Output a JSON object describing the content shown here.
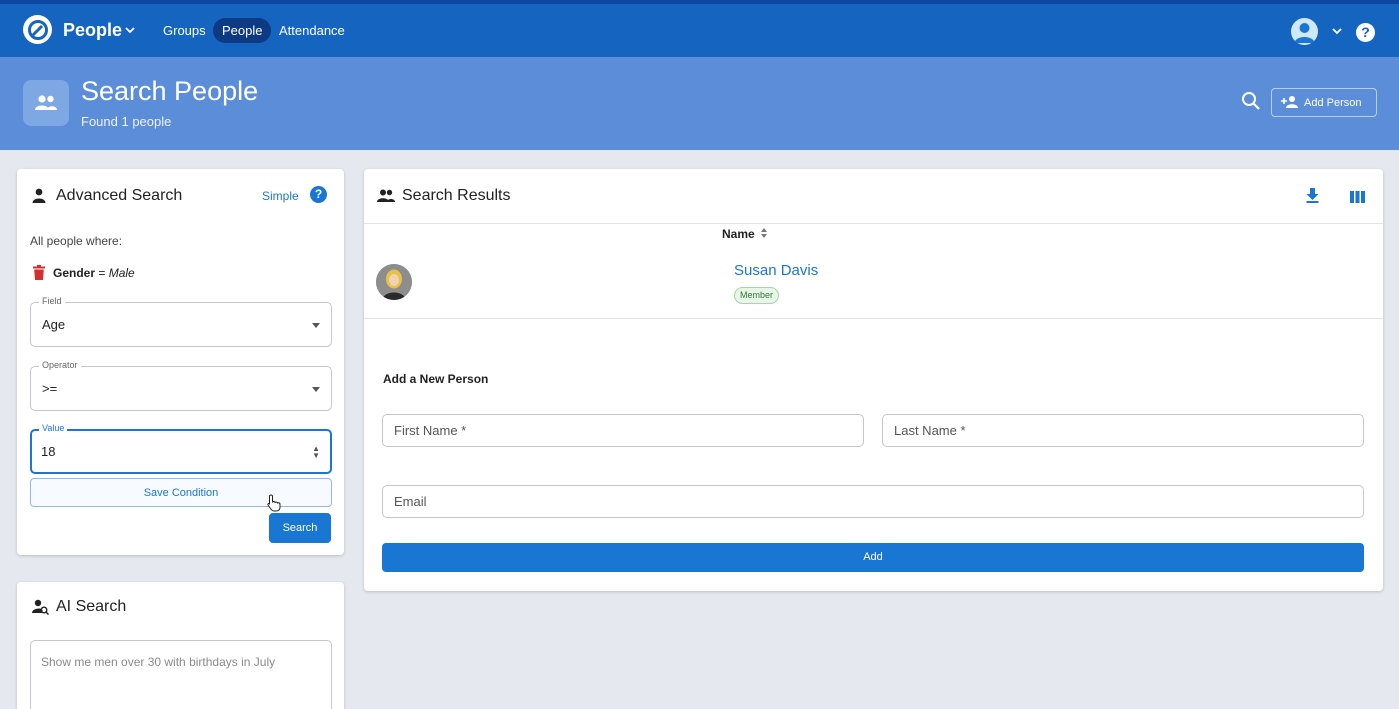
{
  "app": {
    "title": "People"
  },
  "nav": {
    "items": [
      {
        "label": "Groups",
        "active": false
      },
      {
        "label": "People",
        "active": true
      },
      {
        "label": "Attendance",
        "active": false
      }
    ]
  },
  "header": {
    "title": "Search People",
    "subtitle": "Found 1 people",
    "add_person_label": "Add Person"
  },
  "advanced": {
    "title": "Advanced Search",
    "simple_link": "Simple",
    "intro": "All people where:",
    "condition": {
      "field": "Gender",
      "op": "=",
      "value": "Male"
    },
    "field": {
      "legend": "Field",
      "value": "Age"
    },
    "operator": {
      "legend": "Operator",
      "value": ">="
    },
    "value": {
      "legend": "Value",
      "value": "18"
    },
    "save_label": "Save Condition",
    "search_label": "Search"
  },
  "ai": {
    "title": "AI Search",
    "placeholder": "Show me men over 30 with birthdays in July"
  },
  "results": {
    "title": "Search Results",
    "column_name": "Name",
    "rows": [
      {
        "name": "Susan Davis",
        "badge": "Member"
      }
    ]
  },
  "add_form": {
    "title": "Add a New Person",
    "first_name_placeholder": "First Name *",
    "last_name_placeholder": "Last Name *",
    "email_placeholder": "Email",
    "add_label": "Add"
  },
  "colors": {
    "primary": "#1565c0",
    "banner": "#5b8dd9",
    "accent": "#1976d2",
    "danger": "#d32f2f"
  }
}
